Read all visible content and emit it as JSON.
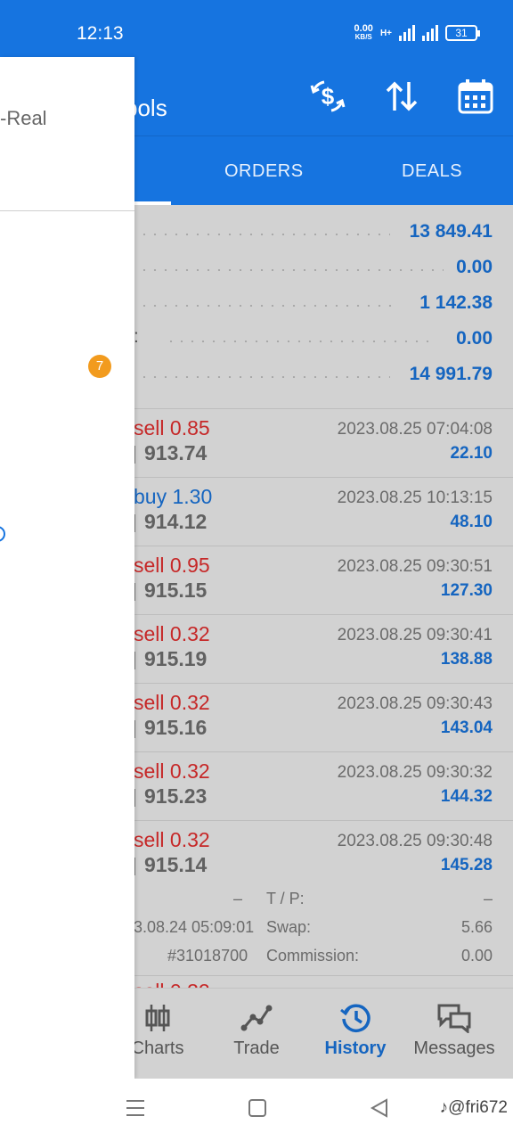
{
  "status_bar": {
    "time": "12:13",
    "net_speed_value": "0.00",
    "net_speed_unit": "KB/S",
    "network_type": "H+",
    "battery": "31"
  },
  "toolbar": {
    "title_partial": "bols",
    "icons": [
      "currency-exchange-icon",
      "sort-icon",
      "calendar-icon"
    ]
  },
  "tabs": {
    "orders": "ORDERS",
    "deals": "DEALS"
  },
  "summary": {
    "rows": [
      {
        "value": "13 849.41"
      },
      {
        "value": "0.00"
      },
      {
        "value": "1 142.38"
      },
      {
        "value": "0.00",
        "label_fragment": ":"
      },
      {
        "value": "14 991.79"
      }
    ]
  },
  "deals": [
    {
      "type": "sell",
      "volume": "sell 0.85",
      "price": "913.74",
      "time": "2023.08.25 07:04:08",
      "profit": "22.10"
    },
    {
      "type": "buy",
      "volume": "buy 1.30",
      "price": "914.12",
      "time": "2023.08.25 10:13:15",
      "profit": "48.10"
    },
    {
      "type": "sell",
      "volume": "sell 0.95",
      "price": "915.15",
      "time": "2023.08.25 09:30:51",
      "profit": "127.30"
    },
    {
      "type": "sell",
      "volume": "sell 0.32",
      "price": "915.19",
      "time": "2023.08.25 09:30:41",
      "profit": "138.88"
    },
    {
      "type": "sell",
      "volume": "sell 0.32",
      "price": "915.16",
      "time": "2023.08.25 09:30:43",
      "profit": "143.04"
    },
    {
      "type": "sell",
      "volume": "sell 0.32",
      "price": "915.23",
      "time": "2023.08.25 09:30:32",
      "profit": "144.32"
    },
    {
      "type": "sell",
      "volume": "sell 0.32",
      "price": "915.14",
      "time": "2023.08.25 09:30:48",
      "profit": "145.28"
    }
  ],
  "deal_details": {
    "sl_value": "–",
    "tp_label": "T / P:",
    "tp_value": "–",
    "open_time": "3.08.24 05:09:01",
    "swap_label": "Swap:",
    "swap_value": "5.66",
    "order_id": "#31018700",
    "commission_label": "Commission:",
    "commission_value": "0.00"
  },
  "bottom_nav": {
    "items": [
      {
        "label": "Charts",
        "icon": "candlestick-icon"
      },
      {
        "label": "Trade",
        "icon": "trade-line-icon"
      },
      {
        "label": "History",
        "icon": "history-clock-icon",
        "active": true
      },
      {
        "label": "Messages",
        "icon": "chat-bubbles-icon"
      }
    ]
  },
  "drawer": {
    "account_fragment": "-Real",
    "badge_count": "7"
  },
  "watermark": "♪@fri672",
  "colors": {
    "primary": "#1674e0",
    "sell": "#c62828",
    "buy": "#1565c0",
    "badge": "#f29b1e"
  }
}
